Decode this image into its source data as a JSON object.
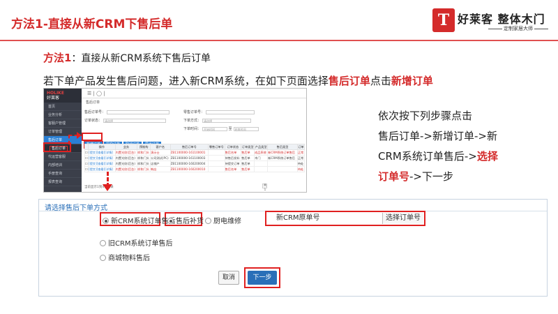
{
  "slide": {
    "title": "方法1-直接从新CRM下售后单",
    "method_label": "方法1",
    "method_text": "：直接从新CRM系统下售后订单",
    "intro_prefix": "若下单产品发生售后问题，进入新CRM系统，在如下页面选择",
    "intro_hl1": "售后订单",
    "intro_mid": "点击",
    "intro_hl2": "新增订单"
  },
  "brand": {
    "mark": "T",
    "name": "好莱客 整体木门",
    "slogan": "定制家居大师"
  },
  "crm": {
    "logo_line1": "HOLIKE",
    "logo_line2": "好莱客",
    "top_icons": "☰ | ◯ |",
    "breadcrumb": "售后订单",
    "nav": [
      "首页",
      "业务分析",
      "客服户管理",
      "订单管理",
      "售后订单",
      "售后订单",
      "代运营客服",
      "内部培训",
      "手册查询",
      "报表查询"
    ],
    "filters": [
      {
        "label": "售后订单号：",
        "value": ""
      },
      {
        "label": "零售订单号：",
        "value": ""
      },
      {
        "label": "订单状态：",
        "value": "请选择"
      },
      {
        "label": "下单方式：",
        "value": "请选择"
      },
      {
        "label": "下单时间：",
        "value": "开始时间"
      },
      {
        "label": "至",
        "value": "结束时间"
      }
    ],
    "buttons": [
      "新增订单",
      "提交订单",
      "取消订单",
      "导出订单"
    ],
    "columns": [
      "",
      "操作",
      "业务",
      "预制构",
      "客户名",
      "售后订单号",
      "零售订单号",
      "订单状态",
      "订单类型",
      "产品类型",
      "售后类型",
      "订单"
    ],
    "rows": [
      [
        "",
        "[提交][查看][详情]",
        "内置光纹(后台)",
        "样和门头",
        "演示士",
        "ZB1100000-161100001",
        "",
        "售后名单",
        "售后单",
        "成品系统",
        "新CRM系统订单售后",
        "正常"
      ],
      [
        "",
        "[提交][查看][详情]",
        "内置光纹(后台)",
        "样和门头",
        "公司测试(PC)",
        "ZB1100000-161100003",
        "",
        "待售后发料",
        "售后单",
        "木门",
        "新CRM系统订单售后",
        "正常"
      ],
      [
        "",
        "[提交][查看][详情]",
        "内置光纹(后台)",
        "样和门头",
        "店铺户",
        "ZB1100000-160200004",
        "",
        "待提交订单",
        "售后单",
        "",
        "",
        "待处"
      ],
      [
        "",
        "[提交][查看][详情]",
        "内置光纹(后台)",
        "样和门头",
        "韩店",
        "ZB1100000-160200010",
        "",
        "售后名单",
        "售后单",
        "",
        "",
        "待处"
      ]
    ],
    "footer_text": "当前显示1到4条记录",
    "pager": [
      "«",
      "1",
      "»"
    ],
    "pager_tail": "共1页 每页显示 10 条"
  },
  "steps": {
    "line1": "依次按下列步骤点击",
    "line2": "售后订单->新增订单->新",
    "line3a": "CRM系统订单售后->",
    "line3b": "选择",
    "line4a": "订单号",
    "line4b": "->下一步"
  },
  "dialog": {
    "title": "请选择售后下单方式",
    "radio_new_crm": "新CRM系统订单售后",
    "radio_after_sale": "售后补货",
    "radio_appliance": "厨电维修",
    "radio_old_crm": "旧CRM系统订单售后",
    "radio_mall": "商城物料售后",
    "order_placeholder": "新CRM原单号",
    "select_order_button": "选择订单号",
    "cancel_button": "取消",
    "next_button": "下一步"
  }
}
